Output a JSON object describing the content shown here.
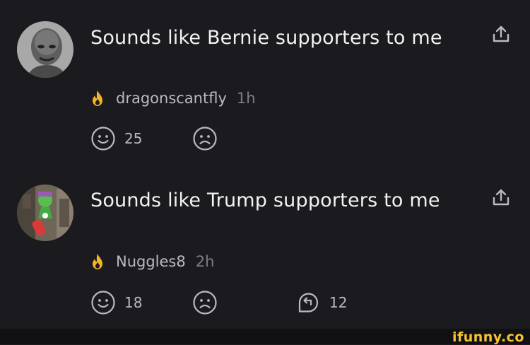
{
  "comments": [
    {
      "text": "Sounds like Bernie supporters to me",
      "username": "dragonscantfly",
      "time": "1h",
      "smile_count": "25",
      "reply_count": ""
    },
    {
      "text": "Sounds like Trump supporters to me",
      "username": "Nuggles8",
      "time": "2h",
      "smile_count": "18",
      "reply_count": "12"
    }
  ],
  "icons": {
    "share": "share-icon",
    "smile": "smile-icon",
    "frown": "frown-icon",
    "reply": "reply-icon",
    "flame": "flame-icon"
  },
  "colors": {
    "background": "#1b1b1f",
    "text": "#f2f2f2",
    "muted": "#7d7d84",
    "flame": "#f5b32a",
    "brand": "#f7c32e"
  },
  "watermark": "ifunny.co"
}
